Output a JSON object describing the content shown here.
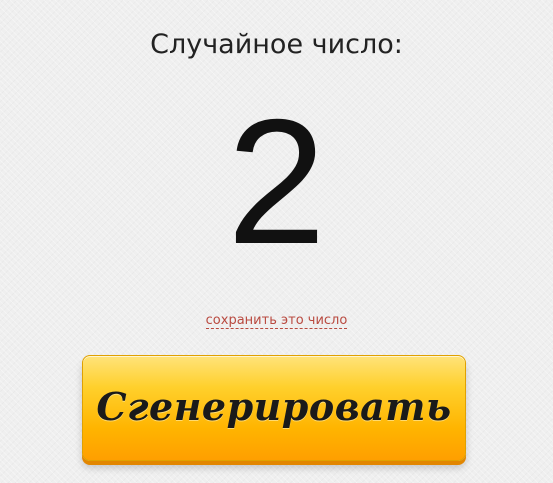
{
  "heading": "Случайное число:",
  "result": "2",
  "save_link": "сохранить это число",
  "generate_button": "Сгенерировать",
  "colors": {
    "background": "#efefef",
    "link": "#b94a40",
    "button_top": "#ffe37a",
    "button_bottom": "#ff9f00"
  }
}
